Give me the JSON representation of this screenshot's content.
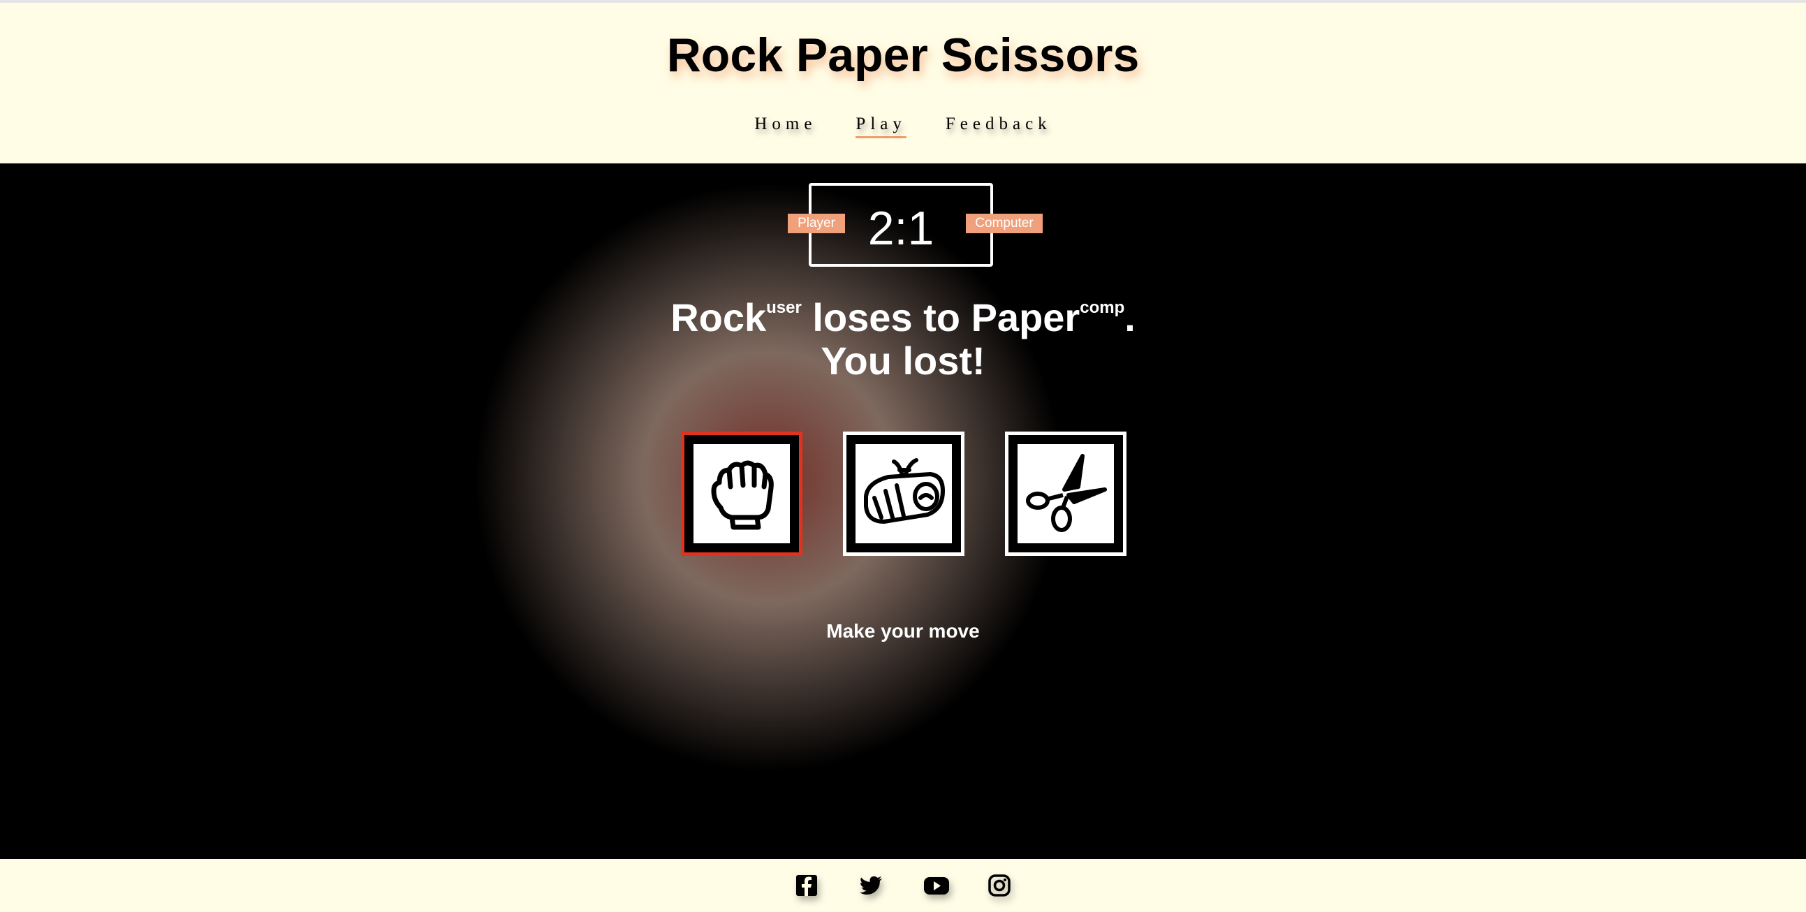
{
  "header": {
    "title": "Rock Paper Scissors",
    "nav": [
      {
        "label": "Home",
        "active": false
      },
      {
        "label": "Play",
        "active": true
      },
      {
        "label": "Feedback",
        "active": false
      }
    ]
  },
  "scoreboard": {
    "score": "2:1",
    "player_label": "Player",
    "computer_label": "Computer"
  },
  "result": {
    "user_choice": "Rock",
    "user_tag": "user",
    "verb": "loses to",
    "comp_choice": "Paper",
    "comp_tag": "comp",
    "period": ".",
    "outcome": "You lost!"
  },
  "choices": [
    {
      "name": "Rock",
      "icon": "fist-icon",
      "selected": true
    },
    {
      "name": "Paper",
      "icon": "newspaper-icon",
      "selected": false
    },
    {
      "name": "Scissors",
      "icon": "scissors-icon",
      "selected": false
    }
  ],
  "prompt": "Make your move",
  "footer": {
    "social": [
      "facebook-icon",
      "twitter-icon",
      "youtube-icon",
      "instagram-icon"
    ]
  },
  "colors": {
    "background_light": "#fffde6",
    "accent_orange": "#f0a07a",
    "selected_red": "#e0321e"
  }
}
